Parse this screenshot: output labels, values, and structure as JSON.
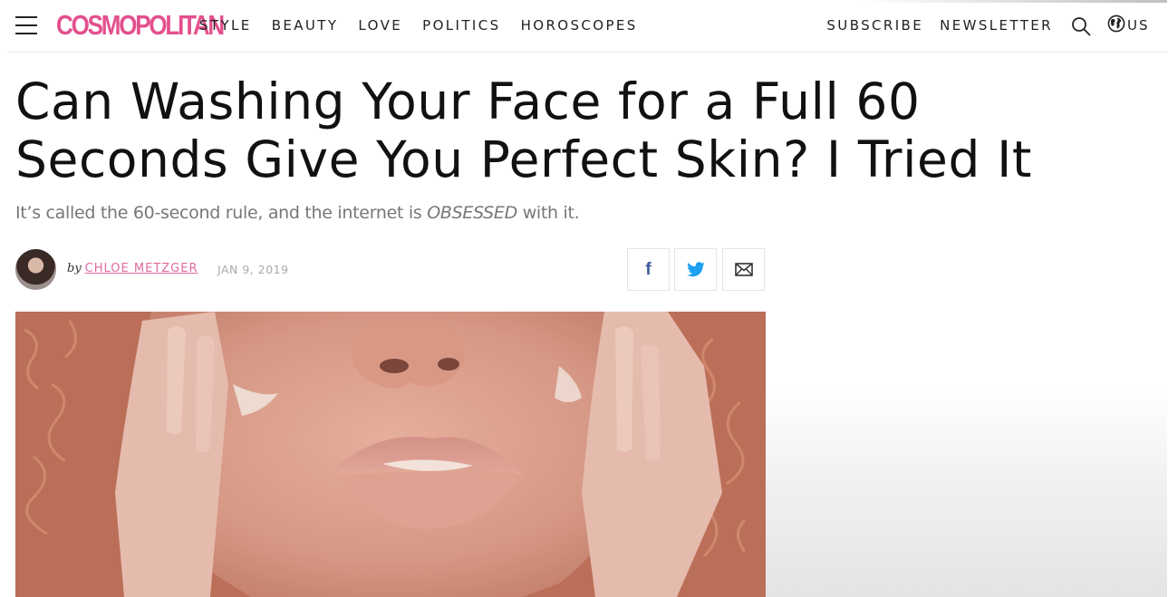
{
  "header": {
    "logo_text": "COSMOPOLITAN",
    "nav_items": [
      "STYLE",
      "BEAUTY",
      "LOVE",
      "POLITICS",
      "HOROSCOPES"
    ],
    "subscribe_label": "SUBSCRIBE",
    "newsletter_label": "NEWSLETTER",
    "region_label": "US"
  },
  "article": {
    "headline": "Can Washing Your Face for a Full 60 Seconds Give You Perfect Skin? I Tried It",
    "dek_before": "It’s called the 60-second rule, and the internet is ",
    "dek_emphasis": "OBSESSED",
    "dek_after": " with it.",
    "byline_prefix": "by",
    "author": "CHLOE METZGER",
    "date": "JAN 9, 2019"
  },
  "share": {
    "facebook_glyph": "f"
  },
  "colors": {
    "brand": "#e3508e",
    "author_link": "#e06aa0",
    "twitter": "#1da1f2",
    "facebook": "#3b5998"
  },
  "icons": {
    "menu": "hamburger-icon",
    "search": "search-icon",
    "region": "globe-icon",
    "facebook": "facebook-icon",
    "twitter": "twitter-icon",
    "email": "envelope-icon"
  }
}
